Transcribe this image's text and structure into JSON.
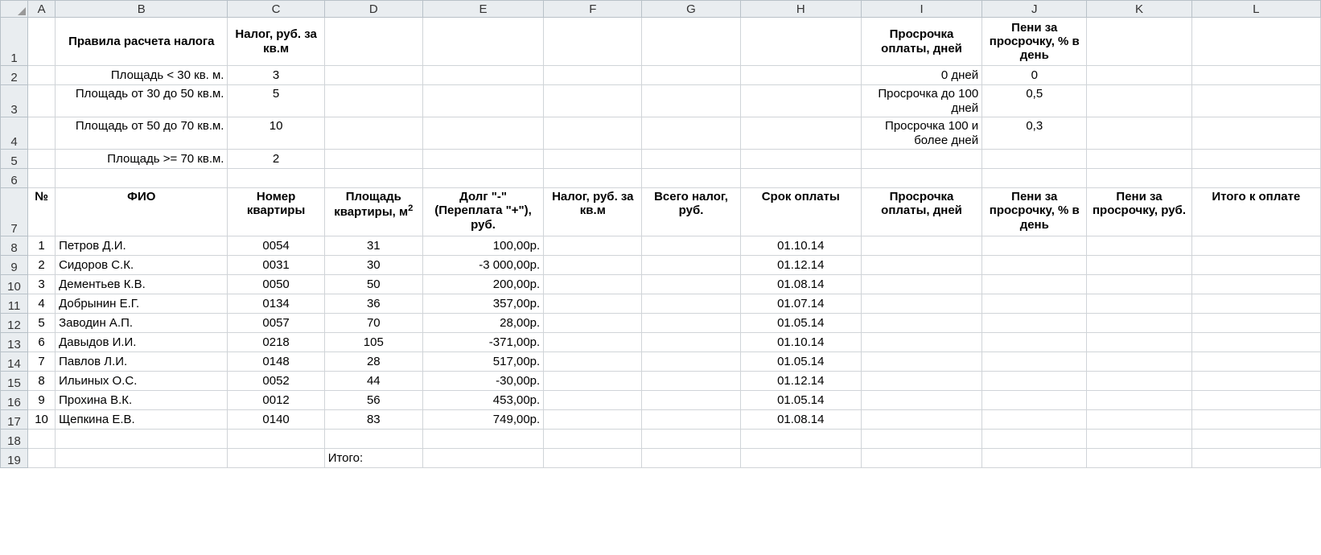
{
  "col_letters": [
    "A",
    "B",
    "C",
    "D",
    "E",
    "F",
    "G",
    "H",
    "I",
    "J",
    "K",
    "L"
  ],
  "row_numbers": [
    "1",
    "2",
    "3",
    "4",
    "5",
    "6",
    "7",
    "8",
    "9",
    "10",
    "11",
    "12",
    "13",
    "14",
    "15",
    "16",
    "17",
    "18",
    "19"
  ],
  "rules_header": {
    "b": "Правила расчета налога",
    "c": "Налог, руб. за кв.м"
  },
  "rules": [
    {
      "b": "Площадь < 30 кв. м.",
      "c": "3"
    },
    {
      "b": "Площадь от 30 до 50 кв.м.",
      "c": "5"
    },
    {
      "b": "Площадь от 50 до 70 кв.м.",
      "c": "10"
    },
    {
      "b": "Площадь >= 70 кв.м.",
      "c": "2"
    }
  ],
  "delay_header": {
    "i": "Просрочка оплаты, дней",
    "j": "Пени за просрочку, % в день"
  },
  "delay_rows": [
    {
      "i": "0 дней",
      "j": "0"
    },
    {
      "i": "Просрочка до 100 дней",
      "j": "0,5"
    },
    {
      "i": "Просрочка 100 и более дней",
      "j": "0,3"
    }
  ],
  "table_header": {
    "a": "№",
    "b": "ФИО",
    "c": "Номер квартиры",
    "d_pre": "Площадь квартиры, м",
    "d_sup": "2",
    "e": "Долг \"-\" (Переплата \"+\"), руб.",
    "f": "Налог, руб. за кв.м",
    "g": "Всего налог, руб.",
    "h": "Срок оплаты",
    "i": "Просрочка оплаты, дней",
    "j": "Пени за просрочку, % в день",
    "k": "Пени за просрочку, руб.",
    "l": "Итого к оплате"
  },
  "data_rows": [
    {
      "n": "1",
      "fio": "Петров Д.И.",
      "apt": "0054",
      "area": "31",
      "debt": "100,00р.",
      "due": "01.10.14"
    },
    {
      "n": "2",
      "fio": "Сидоров С.К.",
      "apt": "0031",
      "area": "30",
      "debt": "-3 000,00р.",
      "due": "01.12.14"
    },
    {
      "n": "3",
      "fio": "Дементьев К.В.",
      "apt": "0050",
      "area": "50",
      "debt": "200,00р.",
      "due": "01.08.14"
    },
    {
      "n": "4",
      "fio": "Добрынин Е.Г.",
      "apt": "0134",
      "area": "36",
      "debt": "357,00р.",
      "due": "01.07.14"
    },
    {
      "n": "5",
      "fio": "Заводин А.П.",
      "apt": "0057",
      "area": "70",
      "debt": "28,00р.",
      "due": "01.05.14"
    },
    {
      "n": "6",
      "fio": "Давыдов И.И.",
      "apt": "0218",
      "area": "105",
      "debt": "-371,00р.",
      "due": "01.10.14"
    },
    {
      "n": "7",
      "fio": "Павлов Л.И.",
      "apt": "0148",
      "area": "28",
      "debt": "517,00р.",
      "due": "01.05.14"
    },
    {
      "n": "8",
      "fio": "Ильиных О.С.",
      "apt": "0052",
      "area": "44",
      "debt": "-30,00р.",
      "due": "01.12.14"
    },
    {
      "n": "9",
      "fio": "Прохина В.К.",
      "apt": "0012",
      "area": "56",
      "debt": "453,00р.",
      "due": "01.05.14"
    },
    {
      "n": "10",
      "fio": "Щепкина Е.В.",
      "apt": "0140",
      "area": "83",
      "debt": "749,00р.",
      "due": "01.08.14"
    }
  ],
  "total_label": "Итого:"
}
